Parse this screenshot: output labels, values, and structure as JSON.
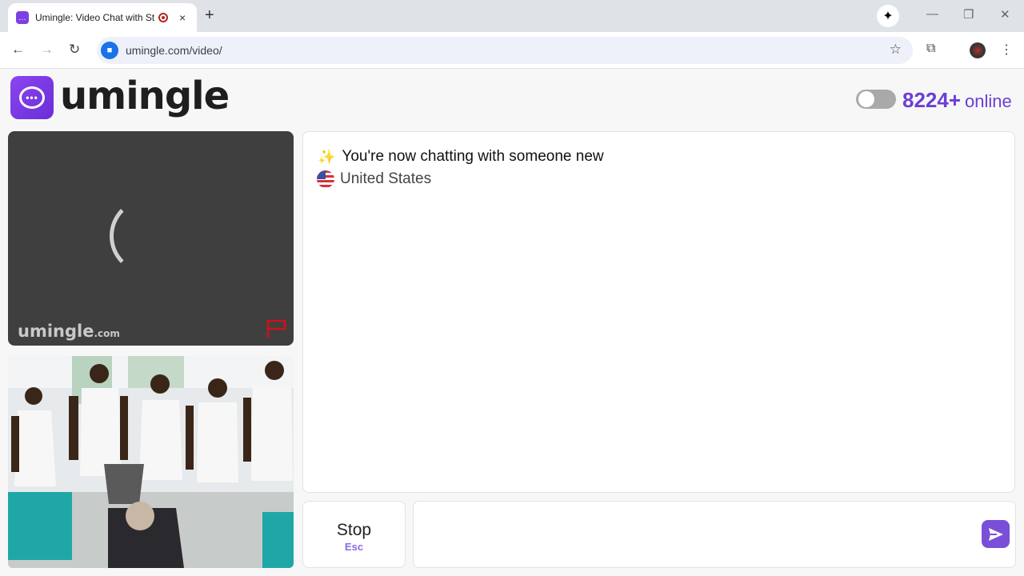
{
  "browser": {
    "tab_title": "Umingle: Video Chat with Strangers",
    "tab_close": "×",
    "new_tab": "+",
    "url": "umingle.com/video/"
  },
  "page": {
    "logo_text": "umingle",
    "online_count": "8224+",
    "online_label": "online",
    "watermark": "umingle",
    "watermark_suffix": ".com",
    "chat_messages": [
      {
        "icon": "sparkles",
        "text": "You're now chatting with someone new"
      },
      {
        "icon": "us-flag",
        "text": "United States"
      }
    ],
    "stop_label": "Stop",
    "stop_shortcut": "Esc",
    "message_input_value": ""
  },
  "colors": {
    "brand": "#7b3fe4",
    "online_text": "#6b3fd2",
    "report_flag": "#d0101a"
  }
}
